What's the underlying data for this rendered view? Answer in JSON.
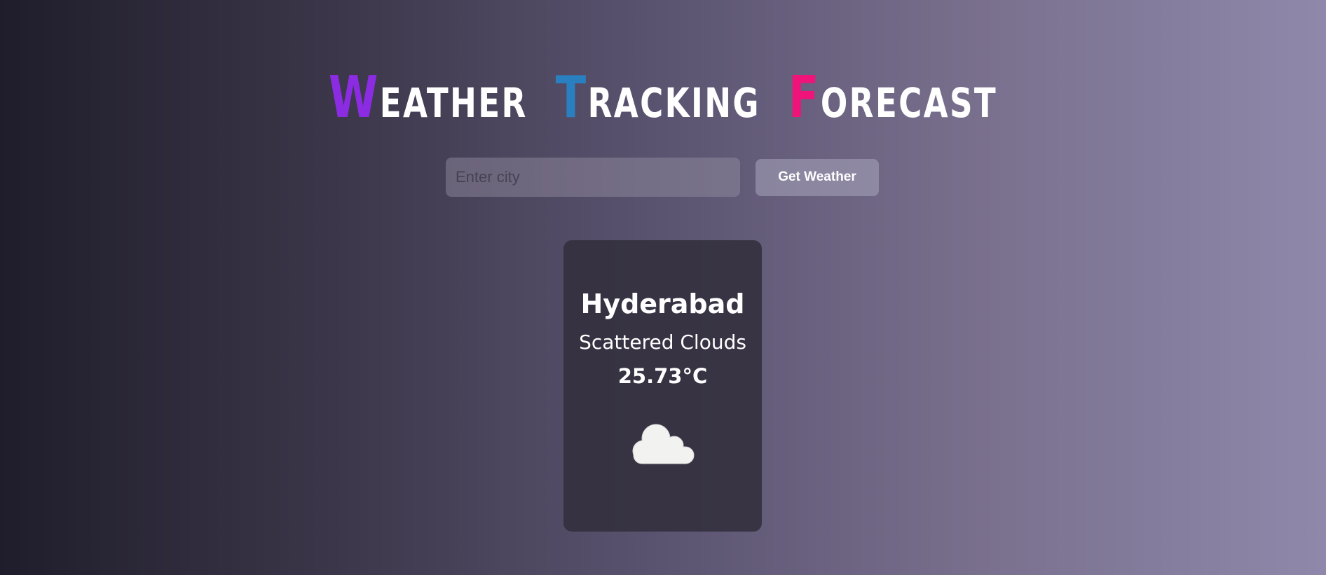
{
  "header": {
    "title_words": [
      {
        "cap": "W",
        "rest": "EATHER",
        "cap_color": "#8b2be2"
      },
      {
        "cap": "T",
        "rest": "RACKING",
        "cap_color": "#2a7fc0"
      },
      {
        "cap": "F",
        "rest": "ORECAST",
        "cap_color": "#f0147a"
      }
    ]
  },
  "search": {
    "value": "",
    "placeholder": "Enter city",
    "button_label": "Get Weather"
  },
  "weather": {
    "city": "Hyderabad",
    "description": "Scattered Clouds",
    "temperature": "25.73°C",
    "icon": "cloud-icon"
  }
}
